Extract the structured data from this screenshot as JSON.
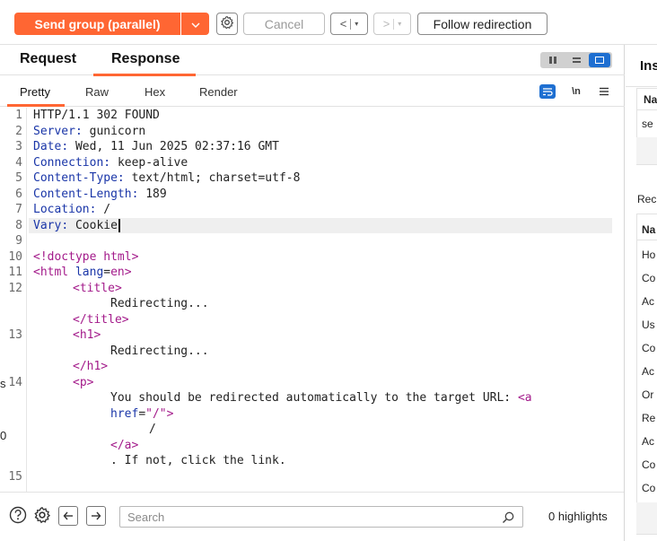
{
  "toolbar": {
    "send_label": "Send group (parallel)",
    "cancel_label": "Cancel",
    "follow_label": "Follow redirection",
    "nav_back": "<",
    "nav_forward": ">",
    "dropdown_glyph": "▾"
  },
  "panel": {
    "tabs": [
      "Request",
      "Response"
    ],
    "active_tab": "Response",
    "view_tabs": [
      "Pretty",
      "Raw",
      "Hex",
      "Render"
    ],
    "active_view": "Pretty",
    "newline_toggle": "\\n"
  },
  "response": {
    "status_line": "HTTP/1.1 302 FOUND",
    "headers": [
      {
        "name": "Server",
        "value": "gunicorn"
      },
      {
        "name": "Date",
        "value": "Wed, 11 Jun 2025 02:37:16 GMT"
      },
      {
        "name": "Connection",
        "value": "keep-alive"
      },
      {
        "name": "Content-Type",
        "value": "text/html; charset=utf-8"
      },
      {
        "name": "Content-Length",
        "value": "189"
      },
      {
        "name": "Location",
        "value": "/"
      },
      {
        "name": "Vary",
        "value": "Cookie"
      }
    ],
    "body": {
      "doctype": "<!doctype html>",
      "html_open": "<html",
      "lang_attr": "lang",
      "lang_value": "en",
      "title_open": "<title>",
      "title_text": "Redirecting...",
      "title_close": "</title>",
      "h1_open": "<h1>",
      "h1_text": "Redirecting...",
      "h1_close": "</h1>",
      "p_open": "<p>",
      "p_text": "You should be redirected automatically to the target URL: ",
      "a_open": "<a",
      "href_attr": "href",
      "href_value": "\"/\"",
      "a_text": "/",
      "a_close": "</a>",
      "p_tail": ". If not, click the link."
    },
    "line_numbers": [
      "1",
      "2",
      "3",
      "4",
      "5",
      "6",
      "7",
      "8",
      "9",
      "10",
      "11",
      "12",
      "13",
      "14",
      "15"
    ]
  },
  "search": {
    "placeholder": "Search",
    "highlights": "0 highlights"
  },
  "inspector": {
    "title": "Ins",
    "row_header": "Na",
    "row_value": "se",
    "section_label": "Rec",
    "section_header": "Na",
    "items": [
      "Ho",
      "Co",
      "Ac",
      "Us",
      "Co",
      "Ac",
      "Or",
      "Re",
      "Ac",
      "Co",
      "Co"
    ]
  },
  "edge_fragments": [
    "s",
    "0"
  ]
}
